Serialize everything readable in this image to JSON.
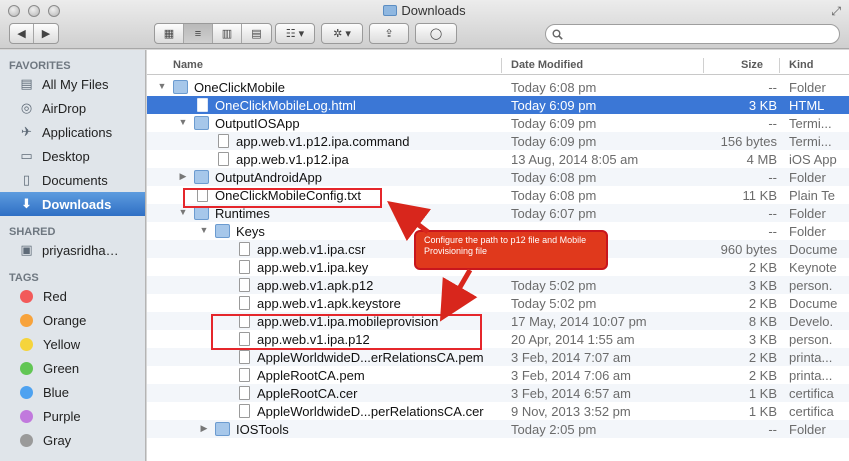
{
  "window": {
    "title": "Downloads"
  },
  "toolbar": {
    "back_label": "◀",
    "forward_label": "▶",
    "views": [
      "▦",
      "≡",
      "▥",
      "▤"
    ],
    "arrange_label": "☷ ▾",
    "action_label": "✲ ▾",
    "share_label": "⇪",
    "tag_label": "◯"
  },
  "search": {
    "placeholder": "",
    "value": ""
  },
  "sidebar": {
    "favorites_heading": "FAVORITES",
    "favorites": [
      {
        "label": "All My Files",
        "icon": "all-files-icon",
        "glyph": "▤"
      },
      {
        "label": "AirDrop",
        "icon": "airdrop-icon",
        "glyph": "◎"
      },
      {
        "label": "Applications",
        "icon": "applications-icon",
        "glyph": "✈"
      },
      {
        "label": "Desktop",
        "icon": "desktop-icon",
        "glyph": "▭"
      },
      {
        "label": "Documents",
        "icon": "documents-icon",
        "glyph": "▯"
      },
      {
        "label": "Downloads",
        "icon": "downloads-icon",
        "glyph": "⬇",
        "selected": true
      }
    ],
    "shared_heading": "SHARED",
    "shared": [
      {
        "label": "priyasridha…",
        "icon": "computer-icon",
        "glyph": "▣"
      }
    ],
    "tags_heading": "TAGS",
    "tags": [
      {
        "label": "Red",
        "color": "#f25a5a"
      },
      {
        "label": "Orange",
        "color": "#f7a33c"
      },
      {
        "label": "Yellow",
        "color": "#f5d43c"
      },
      {
        "label": "Green",
        "color": "#62c654"
      },
      {
        "label": "Blue",
        "color": "#4ea2f0"
      },
      {
        "label": "Purple",
        "color": "#c179dd"
      },
      {
        "label": "Gray",
        "color": "#9a9a9a"
      }
    ]
  },
  "columns": {
    "name": "Name",
    "date": "Date Modified",
    "size": "Size",
    "kind": "Kind"
  },
  "files": [
    {
      "level": 0,
      "type": "folder",
      "open": true,
      "name": "OneClickMobile",
      "date": "Today 6:08 pm",
      "size": "--",
      "kind": "Folder"
    },
    {
      "level": 1,
      "type": "file",
      "name": "OneClickMobileLog.html",
      "date": "Today 6:09 pm",
      "size": "3 KB",
      "kind": "HTML",
      "selected": true
    },
    {
      "level": 1,
      "type": "folder",
      "open": true,
      "name": "OutputIOSApp",
      "date": "Today 6:09 pm",
      "size": "--",
      "kind": "Termi..."
    },
    {
      "level": 2,
      "type": "file",
      "name": "app.web.v1.p12.ipa.command",
      "date": "Today 6:09 pm",
      "size": "156 bytes",
      "kind": "Termi..."
    },
    {
      "level": 2,
      "type": "file",
      "name": "app.web.v1.p12.ipa",
      "date": "13 Aug, 2014 8:05 am",
      "size": "4 MB",
      "kind": "iOS App"
    },
    {
      "level": 1,
      "type": "folder",
      "open": false,
      "name": "OutputAndroidApp",
      "date": "Today 6:08 pm",
      "size": "--",
      "kind": "Folder"
    },
    {
      "level": 1,
      "type": "file",
      "name": "OneClickMobileConfig.txt",
      "date": "Today 6:08 pm",
      "size": "11 KB",
      "kind": "Plain Te"
    },
    {
      "level": 1,
      "type": "folder",
      "open": true,
      "name": "Runtimes",
      "date": "Today 6:07 pm",
      "size": "--",
      "kind": "Folder"
    },
    {
      "level": 2,
      "type": "folder",
      "open": true,
      "name": "Keys",
      "date": "",
      "size": "--",
      "kind": "Folder"
    },
    {
      "level": 3,
      "type": "file",
      "name": "app.web.v1.ipa.csr",
      "date": "",
      "size": "960 bytes",
      "kind": "Docume"
    },
    {
      "level": 3,
      "type": "file",
      "name": "app.web.v1.ipa.key",
      "date": "",
      "size": "2 KB",
      "kind": "Keynote"
    },
    {
      "level": 3,
      "type": "file",
      "name": "app.web.v1.apk.p12",
      "date": "Today 5:02 pm",
      "size": "3 KB",
      "kind": "person."
    },
    {
      "level": 3,
      "type": "file",
      "name": "app.web.v1.apk.keystore",
      "date": "Today 5:02 pm",
      "size": "2 KB",
      "kind": "Docume"
    },
    {
      "level": 3,
      "type": "file",
      "name": "app.web.v1.ipa.mobileprovision",
      "date": "17 May, 2014 10:07 pm",
      "size": "8 KB",
      "kind": "Develo."
    },
    {
      "level": 3,
      "type": "file",
      "name": "app.web.v1.ipa.p12",
      "date": "20 Apr, 2014 1:55 am",
      "size": "3 KB",
      "kind": "person."
    },
    {
      "level": 3,
      "type": "file",
      "name": "AppleWorldwideD...erRelationsCA.pem",
      "date": "3 Feb, 2014 7:07 am",
      "size": "2 KB",
      "kind": "printa..."
    },
    {
      "level": 3,
      "type": "file",
      "name": "AppleRootCA.pem",
      "date": "3 Feb, 2014 7:06 am",
      "size": "2 KB",
      "kind": "printa..."
    },
    {
      "level": 3,
      "type": "file",
      "name": "AppleRootCA.cer",
      "date": "3 Feb, 2014 6:57 am",
      "size": "1 KB",
      "kind": "certifica"
    },
    {
      "level": 3,
      "type": "file",
      "name": "AppleWorldwideD...perRelationsCA.cer",
      "date": "9 Nov, 2013 3:52 pm",
      "size": "1 KB",
      "kind": "certifica"
    },
    {
      "level": 2,
      "type": "folder",
      "open": false,
      "name": "IOSTools",
      "date": "Today 2:05 pm",
      "size": "--",
      "kind": "Folder"
    }
  ],
  "annotation": {
    "callout_text": "Configure the path to p12 file and Mobile Provisioning file",
    "highlight_color": "#e5262b",
    "callout_color": "#e0391c"
  }
}
